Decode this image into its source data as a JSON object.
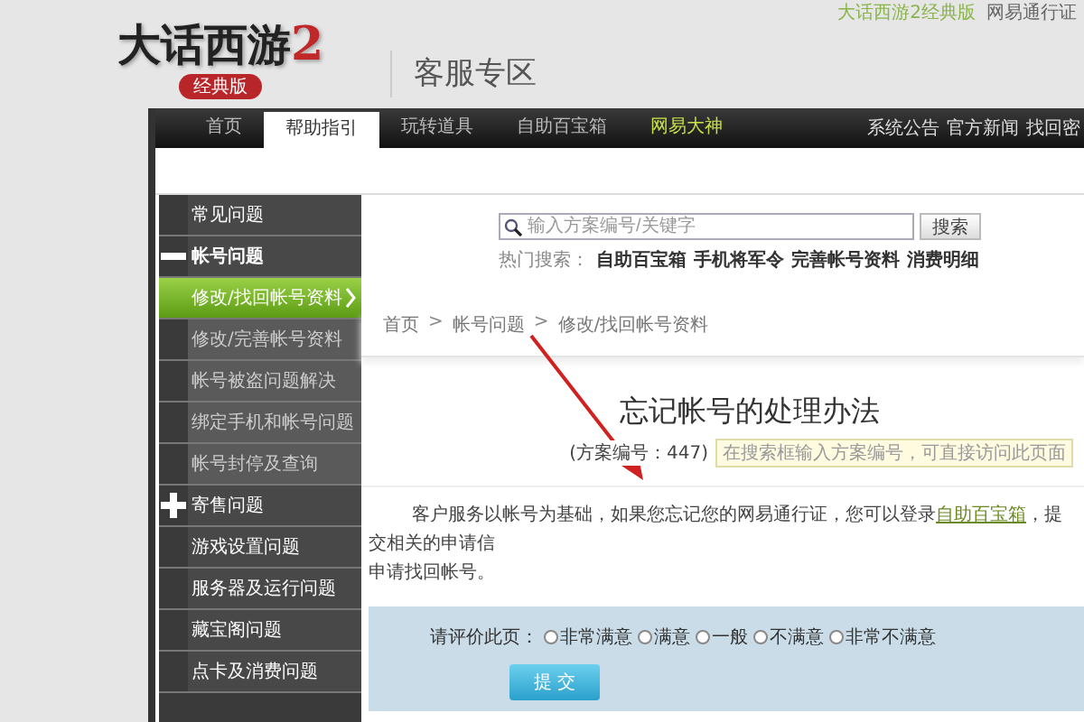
{
  "header": {
    "top_links": [
      "大话西游2经典版",
      "网易通行证"
    ],
    "logo": {
      "title": "大话西游",
      "number": "2",
      "subtitle": "经典版"
    },
    "section_title": "客服专区"
  },
  "nav": {
    "tabs": [
      {
        "label": "首页",
        "selected": false,
        "highlight": false
      },
      {
        "label": "帮助指引",
        "selected": true,
        "highlight": false
      },
      {
        "label": "玩转道具",
        "selected": false,
        "highlight": false
      },
      {
        "label": "自助百宝箱",
        "selected": false,
        "highlight": false
      },
      {
        "label": "网易大神",
        "selected": false,
        "highlight": true
      }
    ],
    "right_links": [
      "系统公告",
      "官方新闻",
      "找回密"
    ]
  },
  "sidebar": {
    "items": [
      {
        "label": "常见问题",
        "selected": false
      },
      {
        "label": "帐号问题",
        "selected": false,
        "expanded": true,
        "children": [
          {
            "label": "修改/找回帐号资料",
            "selected": true
          },
          {
            "label": "修改/完善帐号资料",
            "selected": false
          },
          {
            "label": "帐号被盗问题解决",
            "selected": false
          },
          {
            "label": "绑定手机和帐号问题",
            "selected": false
          },
          {
            "label": "帐号封停及查询",
            "selected": false
          }
        ]
      },
      {
        "label": "寄售问题",
        "selected": false,
        "expanded": false
      },
      {
        "label": "游戏设置问题",
        "selected": false
      },
      {
        "label": "服务器及运行问题",
        "selected": false
      },
      {
        "label": "藏宝阁问题",
        "selected": false
      },
      {
        "label": "点卡及消费问题",
        "selected": false
      }
    ]
  },
  "search": {
    "placeholder": "输入方案编号/关键字",
    "button": "搜索",
    "hot_label": "热门搜索：",
    "hot_links": [
      "自助百宝箱",
      "手机将军令",
      "完善帐号资料",
      "消费明细"
    ]
  },
  "breadcrumb": [
    "首页",
    "帐号问题",
    "修改/找回帐号资料"
  ],
  "breadcrumb_separator": ">",
  "article": {
    "title": "忘记帐号的处理办法",
    "number": "(方案编号：447)",
    "tip": "在搜索框输入方案编号，可直接访问此页面",
    "paragraph_before": "客户服务以帐号为基础，如果您忘记您的网易通行证，您可以登录",
    "paragraph_link": "自助百宝箱",
    "paragraph_after": "，提交相关的申请信",
    "paragraph_line2": "申请找回帐号。"
  },
  "rating": {
    "label": "请评价此页：",
    "options": [
      {
        "label": "非常满意",
        "selected": false
      },
      {
        "label": "满意",
        "selected": false
      },
      {
        "label": "一般",
        "selected": false
      },
      {
        "label": "不满意",
        "selected": false
      },
      {
        "label": "非常不满意",
        "selected": false
      }
    ],
    "submit": "提 交"
  }
}
